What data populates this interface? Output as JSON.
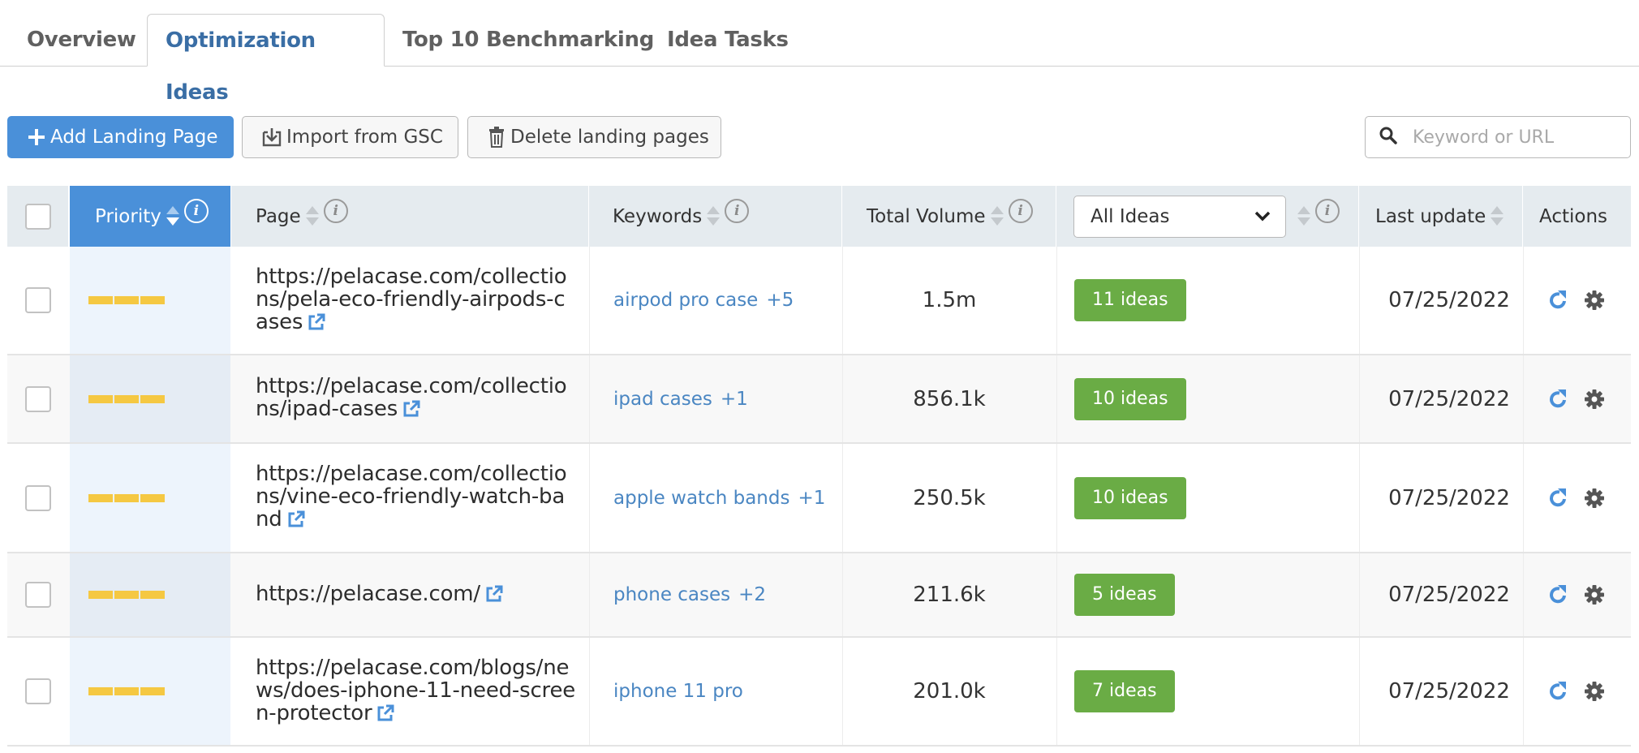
{
  "tabs": [
    {
      "label": "Overview",
      "active": false
    },
    {
      "label": "Optimization Ideas",
      "active": true
    },
    {
      "label": "Top 10 Benchmarking",
      "active": false
    },
    {
      "label": "Idea Tasks",
      "active": false
    }
  ],
  "toolbar": {
    "add_label": "Add Landing Page",
    "import_label": "Import from GSC",
    "delete_label": "Delete landing pages",
    "search_placeholder": "Keyword or URL",
    "search_value": ""
  },
  "table": {
    "headers": {
      "priority": "Priority",
      "page": "Page",
      "keywords": "Keywords",
      "total_volume": "Total Volume",
      "ideas_filter": "All Ideas",
      "last_update": "Last update",
      "actions": "Actions"
    },
    "info_glyph": "i",
    "rows": [
      {
        "priority_level": 3,
        "page": "https://pelacase.com/collections/pela-eco-friendly-airpods-cases",
        "keyword": "airpod pro case",
        "keyword_more": "+5",
        "volume": "1.5m",
        "ideas": "11 ideas",
        "last_update": "07/25/2022"
      },
      {
        "priority_level": 3,
        "page": "https://pelacase.com/collections/ipad-cases",
        "keyword": "ipad cases",
        "keyword_more": "+1",
        "volume": "856.1k",
        "ideas": "10 ideas",
        "last_update": "07/25/2022"
      },
      {
        "priority_level": 3,
        "page": "https://pelacase.com/collections/vine-eco-friendly-watch-band",
        "keyword": "apple watch bands",
        "keyword_more": "+1",
        "volume": "250.5k",
        "ideas": "10 ideas",
        "last_update": "07/25/2022"
      },
      {
        "priority_level": 3,
        "page": "https://pelacase.com/",
        "keyword": "phone cases",
        "keyword_more": "+2",
        "volume": "211.6k",
        "ideas": "5 ideas",
        "last_update": "07/25/2022"
      },
      {
        "priority_level": 3,
        "page": "https://pelacase.com/blogs/news/does-iphone-11-need-screen-protector",
        "keyword": "iphone 11 pro",
        "keyword_more": "",
        "volume": "201.0k",
        "ideas": "7 ideas",
        "last_update": "07/25/2022"
      }
    ]
  },
  "colors": {
    "accent": "#4a90d9",
    "active_tab_text": "#3a6ea5",
    "ideas_badge": "#6aac45",
    "priority_bar": "#f5c842",
    "link": "#4a86c2"
  }
}
